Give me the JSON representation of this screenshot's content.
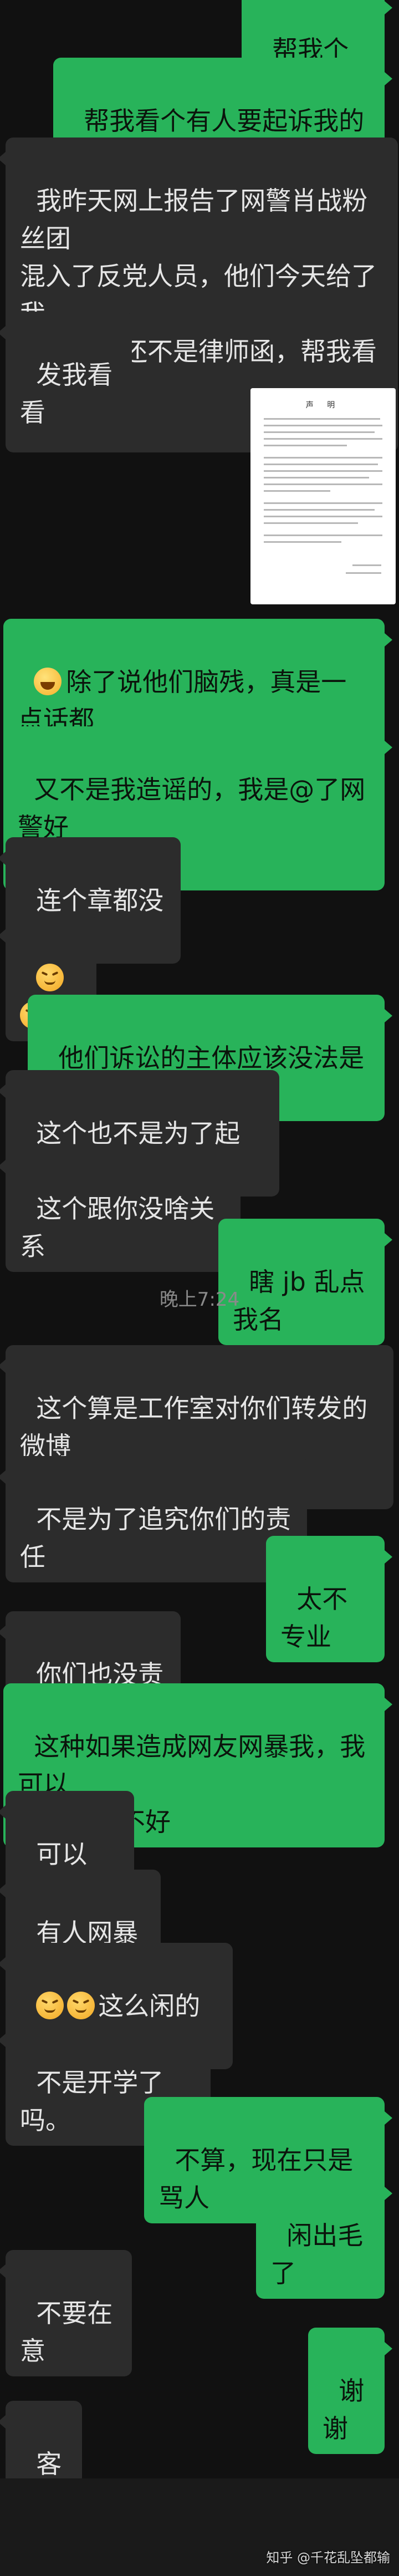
{
  "messages": [
    {
      "id": "m1",
      "side": "right",
      "text": "帮我个忙呗"
    },
    {
      "id": "m2",
      "side": "right",
      "text": "帮我看个有人要起诉我的声明"
    },
    {
      "id": "m3",
      "side": "left",
      "text": "我昨天网上报告了网警肖战粉丝团\n混入了反党人员，他们今天给了我\n张声明，还不是律师函，帮我看看\n呗"
    },
    {
      "id": "m4",
      "side": "left",
      "text": "发我看看"
    },
    {
      "id": "m6",
      "side": "right",
      "text": "除了说他们脑残，真是一点话都\n没有"
    },
    {
      "id": "m7",
      "side": "right",
      "text": "又不是我造谣的，我是@了网警好\n不好"
    },
    {
      "id": "m8",
      "side": "left",
      "text": "连个章都没有"
    },
    {
      "id": "m10",
      "side": "right",
      "text": "他们诉讼的主体应该没法是我呀"
    },
    {
      "id": "m11",
      "side": "left",
      "text": "这个也不是为了起诉你"
    },
    {
      "id": "m12",
      "side": "left",
      "text": "这个跟你没啥关系"
    },
    {
      "id": "m13",
      "side": "right",
      "text": "瞎 jb 乱点我名"
    },
    {
      "id": "m14",
      "side": "left",
      "text": "这个算是工作室对你们转发的微博\n的一个回应。"
    },
    {
      "id": "m15",
      "side": "left",
      "text": "不是为了追究你们的责任"
    },
    {
      "id": "m16",
      "side": "right",
      "text": "太不专业"
    },
    {
      "id": "m17",
      "side": "left",
      "text": "你们也没责任"
    },
    {
      "id": "m18",
      "side": "right",
      "text": "这种如果造成网友网暴我，我可以\n告他们好不好"
    },
    {
      "id": "m19",
      "side": "left",
      "text": "可以"
    },
    {
      "id": "m20",
      "side": "left",
      "text": "有人网暴你?"
    },
    {
      "id": "m21",
      "side": "left",
      "text": "这么闲的吗?"
    },
    {
      "id": "m22",
      "side": "left",
      "text": "不是开学了吗。"
    },
    {
      "id": "m23",
      "side": "right",
      "text": "不算，现在只是骂人"
    },
    {
      "id": "m24",
      "side": "right",
      "text": "闲出毛了"
    },
    {
      "id": "m25",
      "side": "left",
      "text": "不要在意"
    },
    {
      "id": "m26",
      "side": "right",
      "text": "谢谢"
    },
    {
      "id": "m27",
      "side": "left",
      "text": "客气"
    }
  ],
  "timestamp": "晚上7:24",
  "document_image": {
    "title": "声 明"
  },
  "emoji_names": [
    "laugh-emoji",
    "smirk-emoji"
  ],
  "watermark": "知乎 @千花乱坠都输",
  "colors": {
    "background": "#111111",
    "my_bubble": "#28b35a",
    "their_bubble": "#2c2c2c"
  }
}
